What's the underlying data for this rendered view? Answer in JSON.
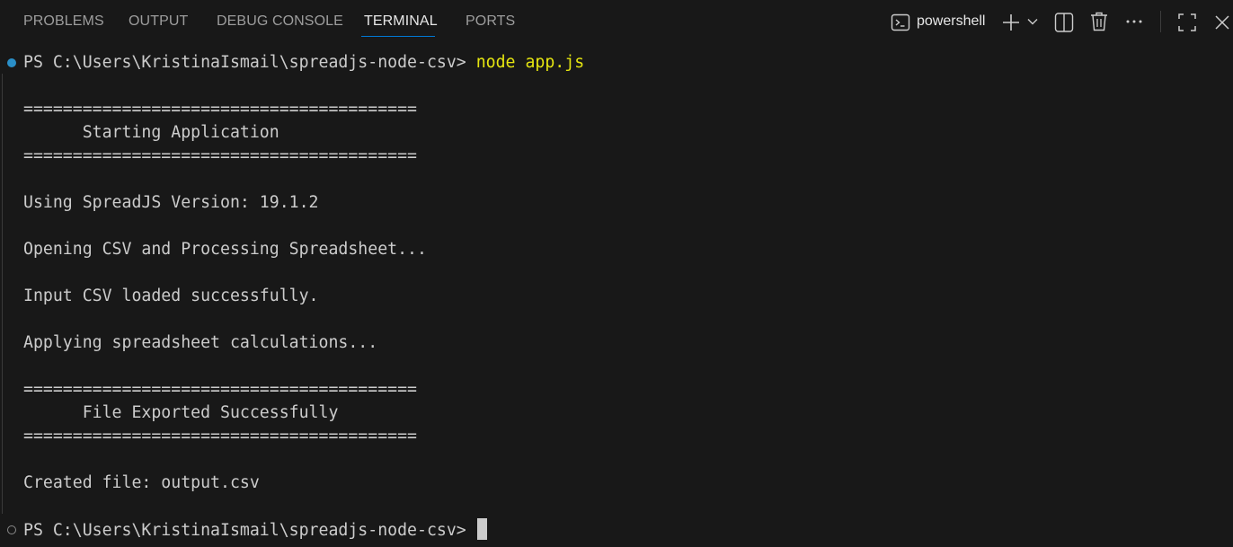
{
  "tabs": [
    {
      "label": "PROBLEMS"
    },
    {
      "label": "OUTPUT"
    },
    {
      "label": "DEBUG CONSOLE"
    },
    {
      "label": "TERMINAL",
      "active": true
    },
    {
      "label": "PORTS"
    }
  ],
  "toolbar": {
    "shell_name": "powershell",
    "icons": [
      "terminal-icon",
      "plus-icon",
      "chevron-down-icon",
      "split-icon",
      "trash-icon",
      "more-icon",
      "maximize-icon",
      "close-icon"
    ]
  },
  "terminal": {
    "prompt": "PS C:\\Users\\KristinaIsmail\\spreadjs-node-csv> ",
    "command": "node app.js",
    "lines": [
      "",
      "========================================",
      "      Starting Application",
      "========================================",
      "",
      "Using SpreadJS Version: 19.1.2",
      "",
      "Opening CSV and Processing Spreadsheet...",
      "",
      "Input CSV loaded successfully.",
      "",
      "Applying spreadsheet calculations...",
      "",
      "========================================",
      "      File Exported Successfully",
      "========================================",
      "",
      "Created file: output.csv",
      ""
    ],
    "final_prompt": "PS C:\\Users\\KristinaIsmail\\spreadjs-node-csv> "
  },
  "colors": {
    "background": "#181818",
    "command": "#e5e510",
    "text": "#cccccc",
    "tab_active_underline": "#0078d4",
    "success_dot": "#2a8fc8"
  }
}
